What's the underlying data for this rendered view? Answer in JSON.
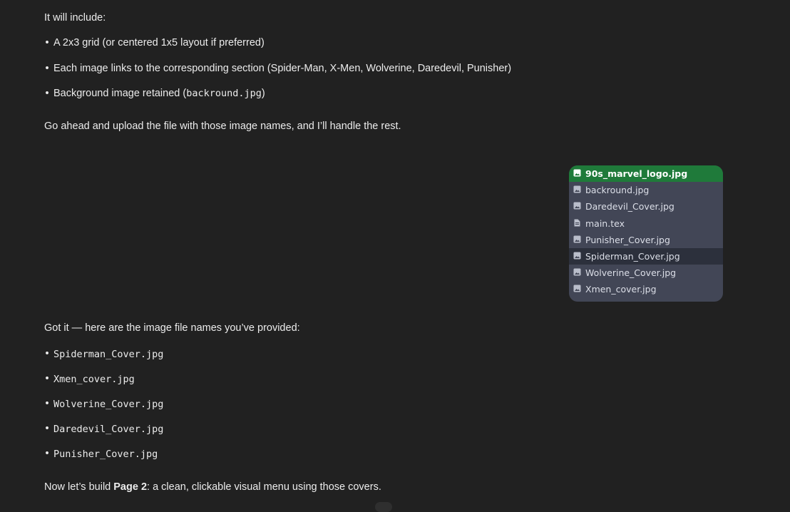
{
  "intro": {
    "heading": "It will include:",
    "bullets": [
      "A 2x3 grid (or centered 1x5 layout if preferred)",
      "Each image links to the corresponding section (Spider-Man, X-Men, Wolverine, Daredevil, Punisher)",
      "Background image retained ("
    ],
    "bullet3_code": "backround.jpg",
    "bullet3_tail": ")",
    "upload_note": "Go ahead and upload the file with those image names, and I’ll handle the rest."
  },
  "file_panel": {
    "files": [
      {
        "name": "90s_marvel_logo.jpg",
        "icon": "image-file-icon",
        "state": "selected"
      },
      {
        "name": "backround.jpg",
        "icon": "image-file-icon",
        "state": "normal"
      },
      {
        "name": "Daredevil_Cover.jpg",
        "icon": "image-file-icon",
        "state": "normal"
      },
      {
        "name": "main.tex",
        "icon": "text-file-icon",
        "state": "normal"
      },
      {
        "name": "Punisher_Cover.jpg",
        "icon": "image-file-icon",
        "state": "normal"
      },
      {
        "name": "Spiderman_Cover.jpg",
        "icon": "image-file-icon",
        "state": "hover"
      },
      {
        "name": "Wolverine_Cover.jpg",
        "icon": "image-file-icon",
        "state": "normal"
      },
      {
        "name": "Xmen_cover.jpg",
        "icon": "image-file-icon",
        "state": "normal"
      }
    ],
    "selected_color": "#1f7a3a"
  },
  "reply": {
    "intro": "Got it — here are the image file names you’ve provided:",
    "files": [
      "Spiderman_Cover.jpg",
      "Xmen_cover.jpg",
      "Wolverine_Cover.jpg",
      "Daredevil_Cover.jpg",
      "Punisher_Cover.jpg"
    ],
    "outro_prefix": "Now let’s build ",
    "outro_bold": "Page 2",
    "outro_suffix": ": a clean, clickable visual menu using those covers."
  },
  "bullet_char": "•"
}
